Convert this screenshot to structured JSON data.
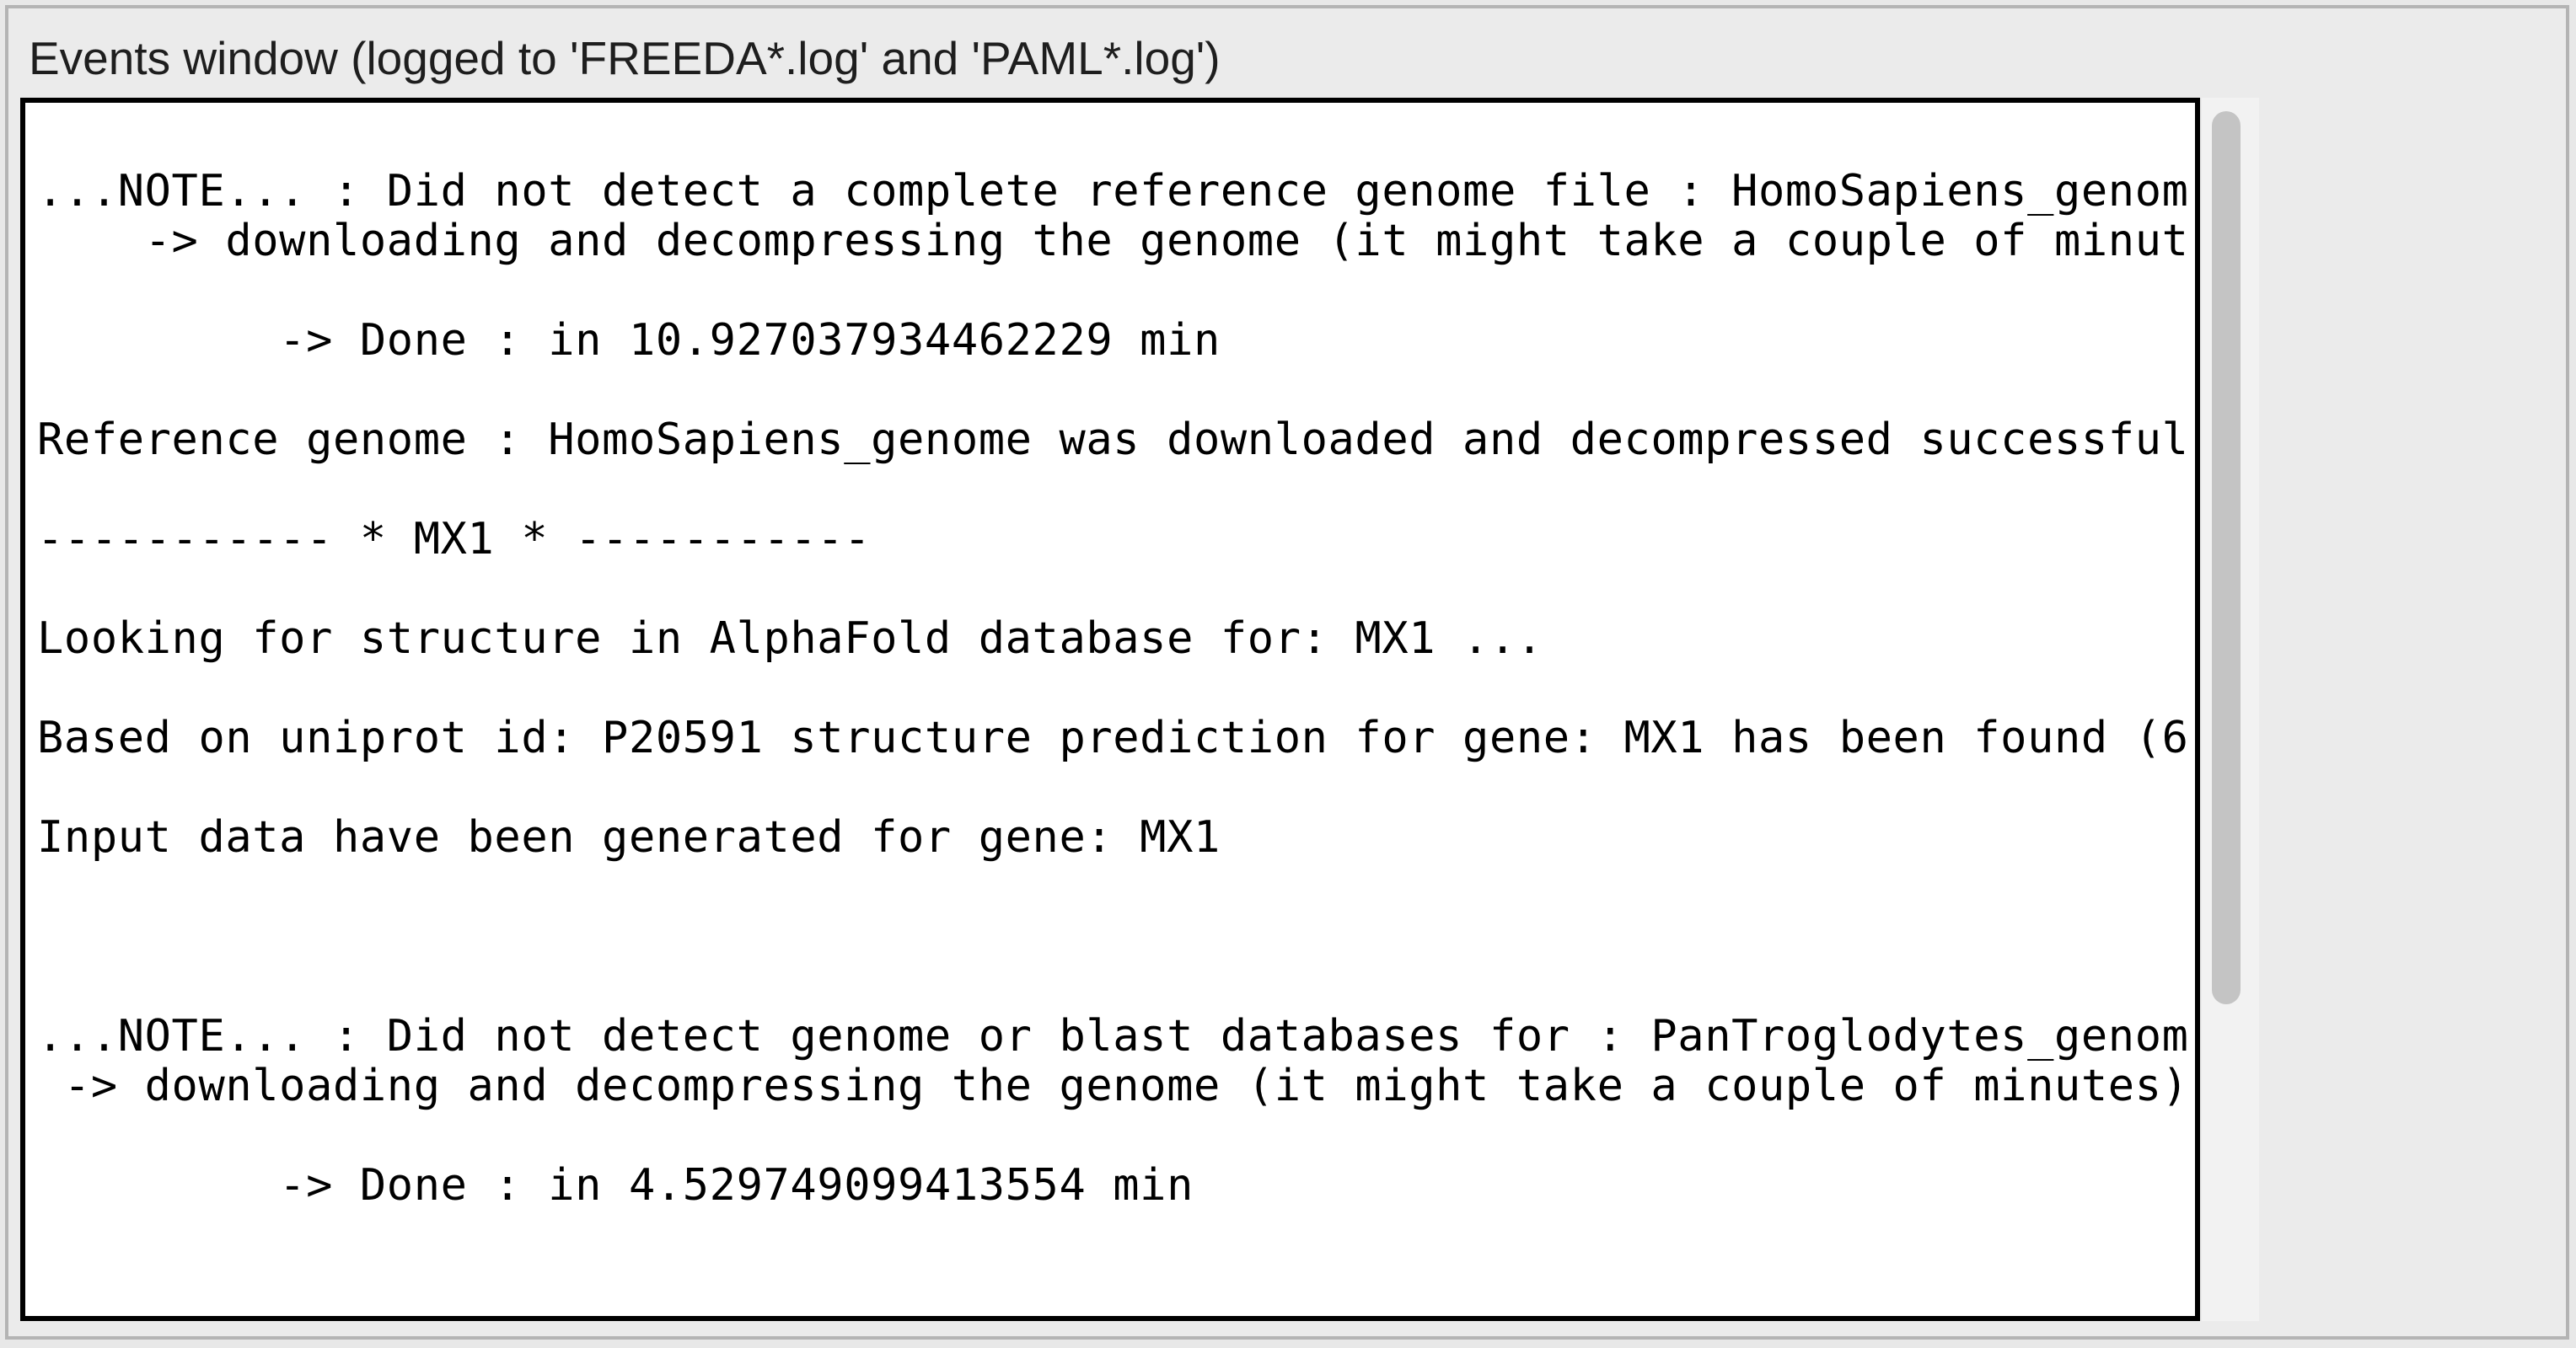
{
  "events_panel": {
    "title": "Events window (logged to 'FREEDA*.log' and 'PAML*.log')",
    "log_lines": [
      "...NOTE... : Did not detect a complete reference genome file : HomoSapiens_genom",
      "    -> downloading and decompressing the genome (it might take a couple of minut",
      "",
      "         -> Done : in 10.927037934462229 min",
      "",
      "Reference genome : HomoSapiens_genome was downloaded and decompressed successful",
      "",
      "----------- * MX1 * -----------",
      "",
      "Looking for structure in AlphaFold database for: MX1 ...",
      "",
      "Based on uniprot id: P20591 structure prediction for gene: MX1 has been found (6",
      "",
      "Input data have been generated for gene: MX1",
      "",
      "",
      "",
      "...NOTE... : Did not detect genome or blast databases for : PanTroglodytes_genom",
      " -> downloading and decompressing the genome (it might take a couple of minutes)",
      "",
      "         -> Done : in 4.529749099413554 min"
    ],
    "scrollbar": {
      "position_fraction": 0.0
    }
  }
}
